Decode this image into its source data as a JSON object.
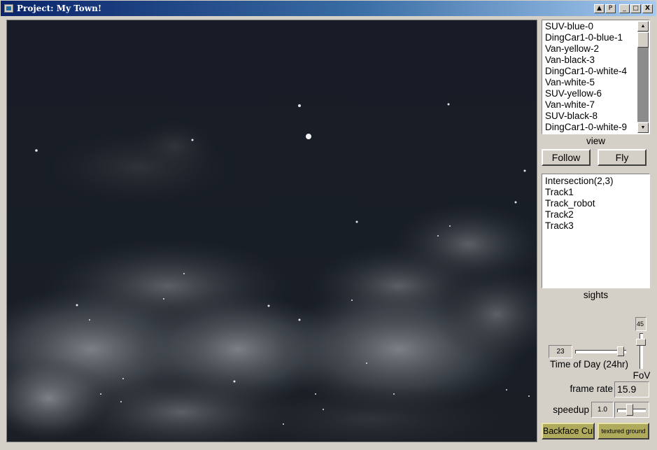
{
  "window": {
    "title": "Project: My Town!",
    "controls": {
      "help": "▲",
      "pin": "P",
      "minimize": "_",
      "maximize": "□",
      "close": "X"
    }
  },
  "vehicles": {
    "items": [
      "SUV-blue-0",
      "DingCar1-0-blue-1",
      "Van-yellow-2",
      "Van-black-3",
      "DingCar1-0-white-4",
      "Van-white-5",
      "SUV-yellow-6",
      "Van-white-7",
      "SUV-black-8",
      "DingCar1-0-white-9"
    ],
    "caption": "view"
  },
  "view_buttons": {
    "follow": "Follow",
    "fly": "Fly"
  },
  "sights": {
    "items": [
      "Intersection(2,3)",
      "Track1",
      "Track_robot",
      "Track2",
      "Track3"
    ],
    "caption": "sights"
  },
  "time_of_day": {
    "value": "23",
    "label": "Time of Day (24hr)",
    "level": 0.96
  },
  "fov": {
    "value": "45",
    "label": "FoV",
    "level": 0.2
  },
  "frame_rate": {
    "label": "frame rate",
    "value": "15.9"
  },
  "speedup": {
    "label": "speedup",
    "value": "1.0",
    "level": 0.4
  },
  "toggles": {
    "backface": "Backface Cull",
    "ground": "textured ground"
  },
  "colors": {
    "sky": "#151a22",
    "cloud": "#8a8e94",
    "toggle": "#b0aa5c"
  }
}
